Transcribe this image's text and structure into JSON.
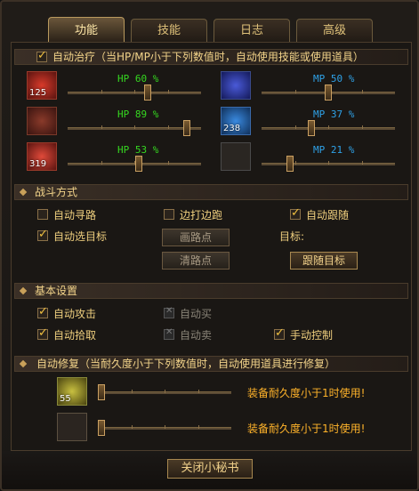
{
  "tabs": [
    {
      "label": "功能"
    },
    {
      "label": "技能"
    },
    {
      "label": "日志"
    },
    {
      "label": "高级"
    }
  ],
  "auto_heal": {
    "checked": true,
    "title": "自动治疗（当HP/MP小于下列数值时，自动使用技能或使用道具）",
    "hp_rows": [
      {
        "label": "HP 60 %",
        "value": 60,
        "item_count": "125"
      },
      {
        "label": "HP 89 %",
        "value": 89,
        "item_count": ""
      },
      {
        "label": "HP 53 %",
        "value": 53,
        "item_count": "319"
      }
    ],
    "mp_rows": [
      {
        "label": "MP 50 %",
        "value": 50,
        "item_count": ""
      },
      {
        "label": "MP 37 %",
        "value": 37,
        "item_count": "238"
      },
      {
        "label": "MP 21 %",
        "value": 21,
        "item_count": ""
      }
    ]
  },
  "combat": {
    "title": "战斗方式",
    "auto_path": {
      "label": "自动寻路",
      "checked": false
    },
    "hit_and_run": {
      "label": "边打边跑",
      "checked": false
    },
    "auto_follow": {
      "label": "自动跟随",
      "checked": true
    },
    "auto_target": {
      "label": "自动选目标",
      "checked": true
    },
    "draw_path_button": "画路点",
    "clear_path_button": "清路点",
    "target_label": "目标:",
    "follow_target_button": "跟随目标"
  },
  "basic": {
    "title": "基本设置",
    "auto_attack": {
      "label": "自动攻击",
      "checked": true
    },
    "auto_buy": {
      "label": "自动买",
      "checked": false,
      "disabled": true
    },
    "auto_pickup": {
      "label": "自动拾取",
      "checked": true
    },
    "auto_sell": {
      "label": "自动卖",
      "checked": false,
      "disabled": true
    },
    "manual_control": {
      "label": "手动控制",
      "checked": true
    }
  },
  "repair": {
    "title": "自动修复（当耐久度小于下列数值时，自动使用道具进行修复）",
    "rows": [
      {
        "text": "装备耐久度小于1时使用!",
        "item_count": "55",
        "value": 1
      },
      {
        "text": "装备耐久度小于1时使用!",
        "item_count": "",
        "value": 1
      }
    ]
  },
  "close_button": "关闭小秘书",
  "colors": {
    "hp": "#35d820",
    "mp": "#2fa2e8",
    "accent": "#f0c040",
    "warn": "#ffb32a"
  }
}
